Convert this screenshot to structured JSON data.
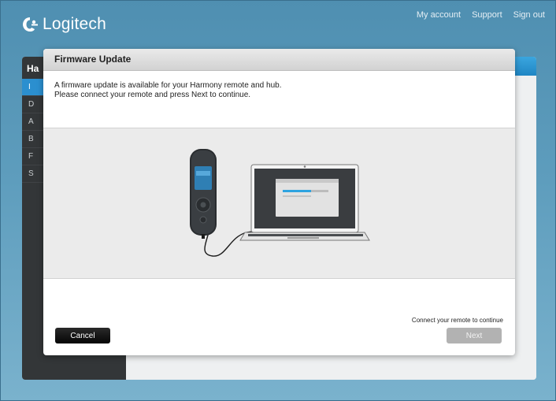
{
  "header": {
    "brand": "Logitech",
    "links": [
      "My account",
      "Support",
      "Sign out"
    ]
  },
  "background_app": {
    "sidebar_title": "Ha",
    "sidebar_items": [
      "I",
      "D",
      "A",
      "B",
      "F",
      "S"
    ]
  },
  "dialog": {
    "title": "Firmware Update",
    "message_line1": "A firmware update is available for your Harmony remote and hub.",
    "message_line2": "Please connect your remote and press Next to continue.",
    "footer_note": "Connect your remote to continue",
    "cancel_label": "Cancel",
    "next_label": "Next",
    "next_enabled": false
  },
  "colors": {
    "accent_blue": "#2b8fcf",
    "background": "#5e9dbd",
    "cancel_button": "#111111",
    "next_disabled": "#b2b2b2"
  },
  "icons": [
    "logitech-logo-icon",
    "harmony-remote-icon",
    "laptop-icon",
    "usb-cable-icon"
  ]
}
